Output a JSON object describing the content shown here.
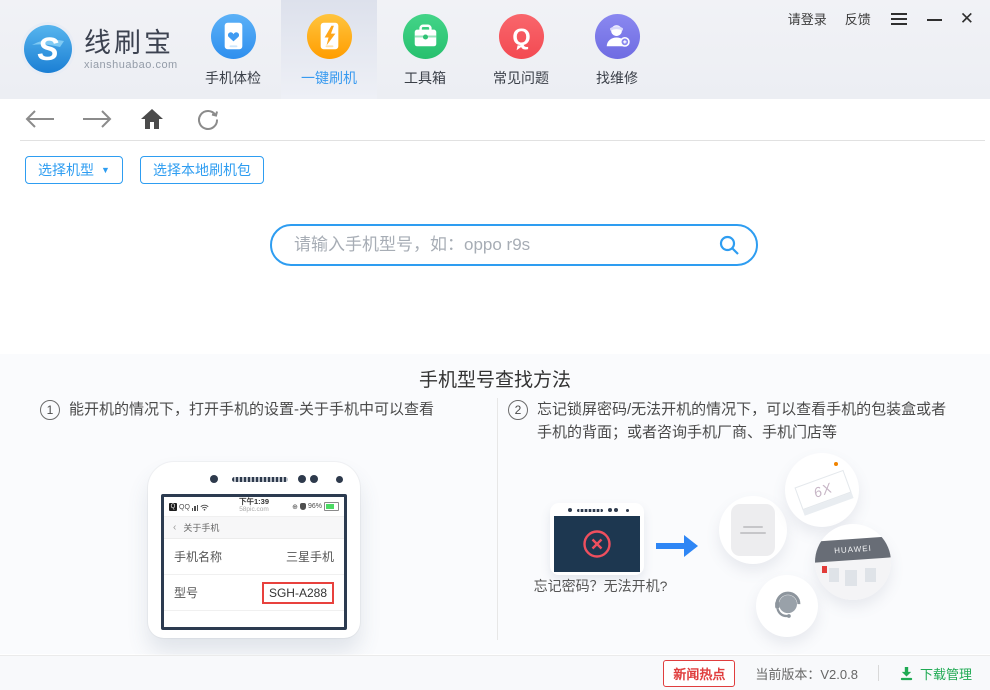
{
  "brand": {
    "name": "线刷宝",
    "domain": "xianshuabao.com"
  },
  "header_right": {
    "login": "请登录",
    "feedback": "反馈"
  },
  "nav": {
    "items": [
      {
        "label": "手机体检",
        "icon": "phone-heart",
        "color": "#3f9bf2"
      },
      {
        "label": "一键刷机",
        "icon": "phone-flash",
        "color": "#ffa71b",
        "active": true
      },
      {
        "label": "工具箱",
        "icon": "toolbox",
        "color": "#35cb7c"
      },
      {
        "label": "常见问题",
        "icon": "question-q",
        "color": "#f7565e"
      },
      {
        "label": "找维修",
        "icon": "repair-person",
        "color": "#7b78e9"
      }
    ]
  },
  "filters": {
    "select_model": "选择机型",
    "select_local_package": "选择本地刷机包"
  },
  "search": {
    "placeholder": "请输入手机型号，如：oppo r9s"
  },
  "guide": {
    "title": "手机型号查找方法",
    "method1": {
      "num": "1",
      "text": "能开机的情况下，打开手机的设置-关于手机中可以查看"
    },
    "method2": {
      "num": "2",
      "text": "忘记锁屏密码/无法开机的情况下，可以查看手机的包装盒或者手机的背面；或者咨询手机厂商、手机门店等"
    },
    "phone_demo": {
      "carrier": "QQ",
      "time": "下午1:39",
      "watermark": "58pic.com",
      "battery": "96%",
      "nav_back": "‹",
      "nav_title": "关于手机",
      "row1_label": "手机名称",
      "row1_value": "三星手机",
      "row2_label": "型号",
      "row2_value": "SGH-A288"
    },
    "locked_caption": "忘记密码？无法开机?",
    "box_label": "6X",
    "store_sign": "HUAWEI"
  },
  "footer": {
    "news": "新闻热点",
    "version": "当前版本：V2.0.8",
    "download": "下载管理"
  },
  "colors": {
    "accent_blue": "#2e9df1",
    "danger_red": "#e03e3e",
    "success_green": "#1faa53",
    "dark_screen": "#1d3750",
    "model_box_red": "#e8413d"
  }
}
